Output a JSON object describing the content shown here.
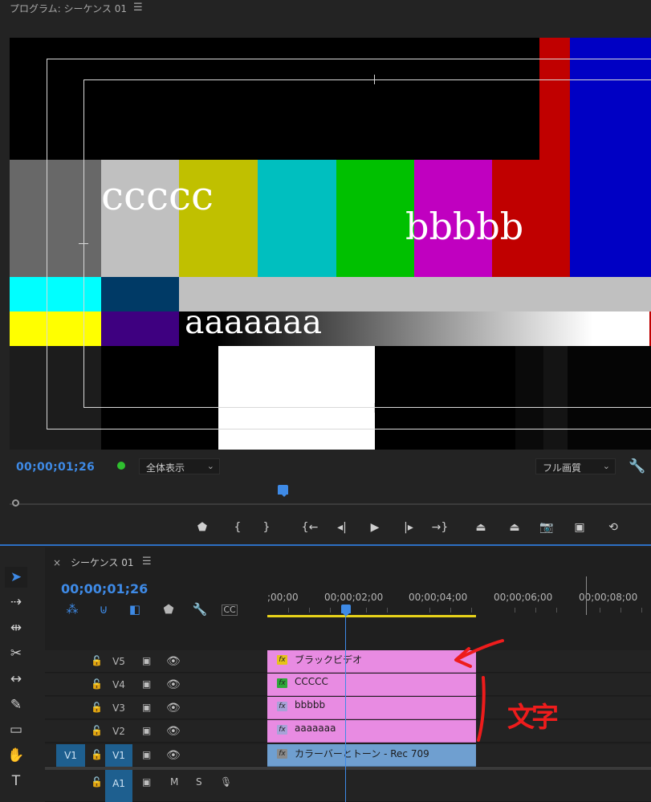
{
  "program_monitor": {
    "title": "プログラム: シーケンス 01",
    "menu_icon": "hamburger-icon",
    "overlays": {
      "text1": "ccccc",
      "text2": "bbbbb",
      "text3": "aaaaaaa"
    },
    "timecode": "00;00;01;26",
    "zoom_label": "全体表示",
    "quality_label": "フル画質",
    "playhead_fraction": 0.42
  },
  "controls": [
    {
      "name": "add-marker-icon",
      "glyph": "⬟"
    },
    {
      "name": "mark-in-icon",
      "glyph": "{"
    },
    {
      "name": "mark-out-icon",
      "glyph": "}"
    },
    {
      "name": "go-to-in-icon",
      "glyph": "{←"
    },
    {
      "name": "step-back-icon",
      "glyph": "◂|"
    },
    {
      "name": "play-icon",
      "glyph": "▶"
    },
    {
      "name": "step-forward-icon",
      "glyph": "|▸"
    },
    {
      "name": "go-to-out-icon",
      "glyph": "→}"
    },
    {
      "name": "lift-icon",
      "glyph": "⏏"
    },
    {
      "name": "extract-icon",
      "glyph": "⏏"
    },
    {
      "name": "export-frame-icon",
      "glyph": "📷"
    },
    {
      "name": "comparison-view-icon",
      "glyph": "▣"
    },
    {
      "name": "vr-icon",
      "glyph": "⟲"
    }
  ],
  "tools": [
    {
      "name": "selection-tool-icon",
      "glyph": "➤"
    },
    {
      "name": "track-select-tool-icon",
      "glyph": "⇢"
    },
    {
      "name": "ripple-edit-tool-icon",
      "glyph": "⇹"
    },
    {
      "name": "razor-tool-icon",
      "glyph": "✂"
    },
    {
      "name": "slip-tool-icon",
      "glyph": "↔"
    },
    {
      "name": "pen-tool-icon",
      "glyph": "✎"
    },
    {
      "name": "rectangle-tool-icon",
      "glyph": "▭"
    },
    {
      "name": "hand-tool-icon",
      "glyph": "✋"
    },
    {
      "name": "type-tool-icon",
      "glyph": "T"
    }
  ],
  "timeline": {
    "title": "シーケンス 01",
    "close": "×",
    "menu_icon": "hamburger-icon",
    "timecode": "00;00;01;26",
    "ruler_labels": [
      ";00;00",
      "00;00;02;00",
      "00;00;04;00",
      "00;00;06;00",
      "00;00;08;00"
    ],
    "tracks": [
      {
        "name": "V5",
        "clip_label": "ブラックビデオ",
        "fx_color": "#e6c31a"
      },
      {
        "name": "V4",
        "clip_label": "CCCCC",
        "fx_color": "#2fa83a"
      },
      {
        "name": "V3",
        "clip_label": "bbbbb",
        "fx_color": "#a7a2d8"
      },
      {
        "name": "V2",
        "clip_label": "aaaaaaa",
        "fx_color": "#a7a2d8"
      },
      {
        "name": "V1",
        "clip_label": "カラーバーとトーン - Rec 709",
        "fx_color": "#8a8a8a",
        "source": "V1"
      }
    ],
    "audio_track": {
      "name": "A1",
      "m": "M",
      "s": "S"
    }
  },
  "annotation": {
    "note": "文字"
  },
  "colors": {
    "accent": "#3e8ae6",
    "clip_pink": "#e88be2",
    "clip_blue": "#6f9fd0",
    "annotation_red": "#ee1c1c"
  }
}
